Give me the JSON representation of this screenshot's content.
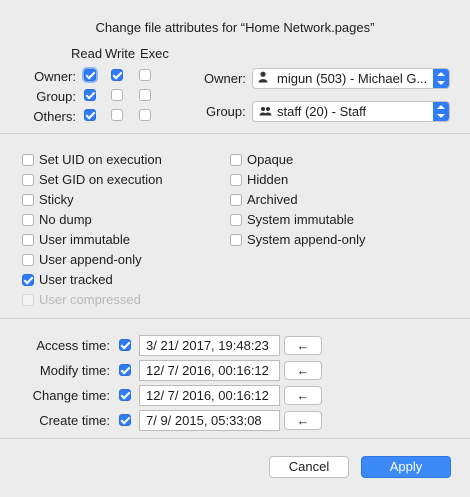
{
  "title": "Change file attributes for “Home Network.pages”",
  "permissions": {
    "headers": [
      "Read",
      "Write",
      "Exec"
    ],
    "rows": [
      {
        "label": "Owner:",
        "read": true,
        "write": true,
        "exec": false
      },
      {
        "label": "Group:",
        "read": true,
        "write": false,
        "exec": false
      },
      {
        "label": "Others:",
        "read": true,
        "write": false,
        "exec": false
      }
    ]
  },
  "owner": {
    "label": "Owner:",
    "value": "migun (503) - Michael G...",
    "icon": "user-icon"
  },
  "group": {
    "label": "Group:",
    "value": "staff (20) - Staff",
    "icon": "group-icon"
  },
  "flags_left": [
    {
      "label": "Set UID on execution",
      "checked": false,
      "enabled": true
    },
    {
      "label": "Set GID on execution",
      "checked": false,
      "enabled": true
    },
    {
      "label": "Sticky",
      "checked": false,
      "enabled": true
    },
    {
      "label": "No dump",
      "checked": false,
      "enabled": true
    },
    {
      "label": "User immutable",
      "checked": false,
      "enabled": true
    },
    {
      "label": "User append-only",
      "checked": false,
      "enabled": true
    },
    {
      "label": "User tracked",
      "checked": true,
      "enabled": true
    },
    {
      "label": "User compressed",
      "checked": false,
      "enabled": false
    }
  ],
  "flags_right": [
    {
      "label": "Opaque",
      "checked": false
    },
    {
      "label": "Hidden",
      "checked": false
    },
    {
      "label": "Archived",
      "checked": false
    },
    {
      "label": "System immutable",
      "checked": false
    },
    {
      "label": "System append-only",
      "checked": false
    }
  ],
  "times": [
    {
      "label": "Access time:",
      "checked": true,
      "value": "3/ 21/ 2017,  19:48:23",
      "button": "←"
    },
    {
      "label": "Modify time:",
      "checked": true,
      "value": "12/  7/ 2016,  00:16:12",
      "button": "←"
    },
    {
      "label": "Change time:",
      "checked": true,
      "value": "12/  7/ 2016,  00:16:12",
      "button": "←"
    },
    {
      "label": "Create time:",
      "checked": true,
      "value": "7/  9/ 2015,  05:33:08",
      "button": "←"
    }
  ],
  "buttons": {
    "cancel": "Cancel",
    "apply": "Apply"
  },
  "colors": {
    "accent": "#2f7cf6",
    "background": "#ececec"
  }
}
